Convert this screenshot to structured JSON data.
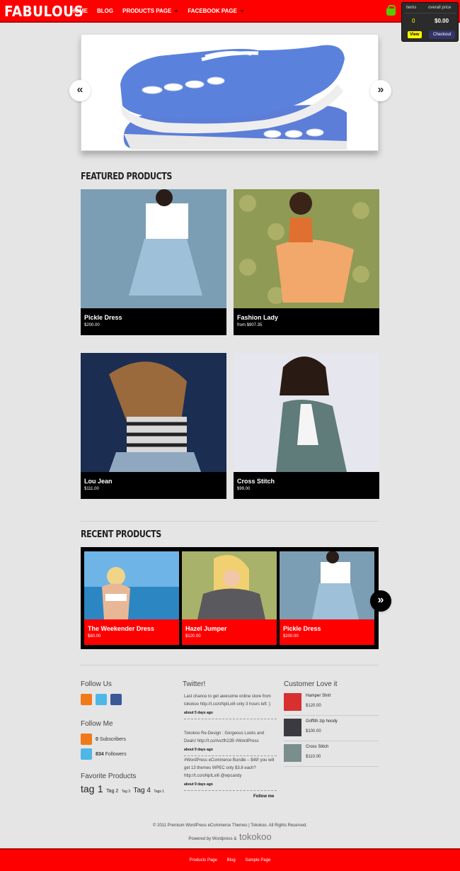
{
  "header": {
    "logo": "FABULOUS",
    "nav": [
      "HOME",
      "BLOG",
      "PRODUCTS PAGE",
      "FACEBOOK PAGE"
    ]
  },
  "cart": {
    "items_label": "items",
    "price_label": "overall price",
    "items": "0",
    "price": "$0.00",
    "view_label": "View",
    "checkout_label": "Checkout"
  },
  "slider": {
    "prev": "«",
    "next": "»"
  },
  "featured": {
    "title": "FEATURED PRODUCTS",
    "products": [
      {
        "name": "Pickle Dress",
        "price": "$200.00"
      },
      {
        "name": "Fashion Lady",
        "price": "from $907.35"
      },
      {
        "name": "Lou Jean",
        "price": "$111.00"
      },
      {
        "name": "Cross Stitch",
        "price": "$99.00"
      }
    ]
  },
  "recent": {
    "title": "RECENT PRODUCTS",
    "next": "»",
    "products": [
      {
        "name": "The Weekender Dress",
        "price": "$80.00"
      },
      {
        "name": "Hazel Jumper",
        "price": "$120.00"
      },
      {
        "name": "Pickle Dress",
        "price": "$200.00"
      }
    ]
  },
  "widgets": {
    "follow_us": "Follow Us",
    "follow_me": "Follow Me",
    "subscribers": "0",
    "subscribers_label": "Subscribers",
    "followers": "834",
    "followers_label": "Followers",
    "favorite_title": "Favorite Products",
    "tags": [
      "tag",
      "1",
      "Tag 2",
      "Tag 3",
      "Tag 4",
      "Tags 1"
    ],
    "twitter_title": "Twitter!",
    "tweets": [
      {
        "text": "Last chance to get awesome online store from tokokoo http://t.co/oNpILxi6 only 3 hours left :)",
        "ago": "about 5 days ago"
      },
      {
        "text": "Tokokoo Re-Design : Gorgeous Looks and Deals! http://t.co/Aozfh22B #WordPress",
        "ago": "about 9 days ago"
      },
      {
        "text": "#WordPress eCommerce Bundle – $49! you will get 13 themes WPEC only $3.8 each? http://t.co/oNpILxi6 @wpcandy",
        "ago": "about 9 days ago"
      }
    ],
    "follow_link": "Follow me",
    "customer_title": "Customer Love it",
    "customer_items": [
      {
        "name": "Hamper Shirt",
        "price": "$120.00"
      },
      {
        "name": "Griffith zip hoody",
        "price": "$100.00"
      },
      {
        "name": "Cross Stitch",
        "price": "$110.00"
      }
    ]
  },
  "credits": {
    "copyright": "© 2011 Premium WordPress eCommerce Themes | Tokokoo. All Rights Reserved.",
    "powered": "Powered by Wordpress &",
    "brand": "tokokoo"
  },
  "footer": {
    "links": [
      "Products Page",
      "Blog",
      "Sample Page"
    ]
  },
  "colors": {
    "accent": "#ff0000",
    "dark": "#000000"
  }
}
